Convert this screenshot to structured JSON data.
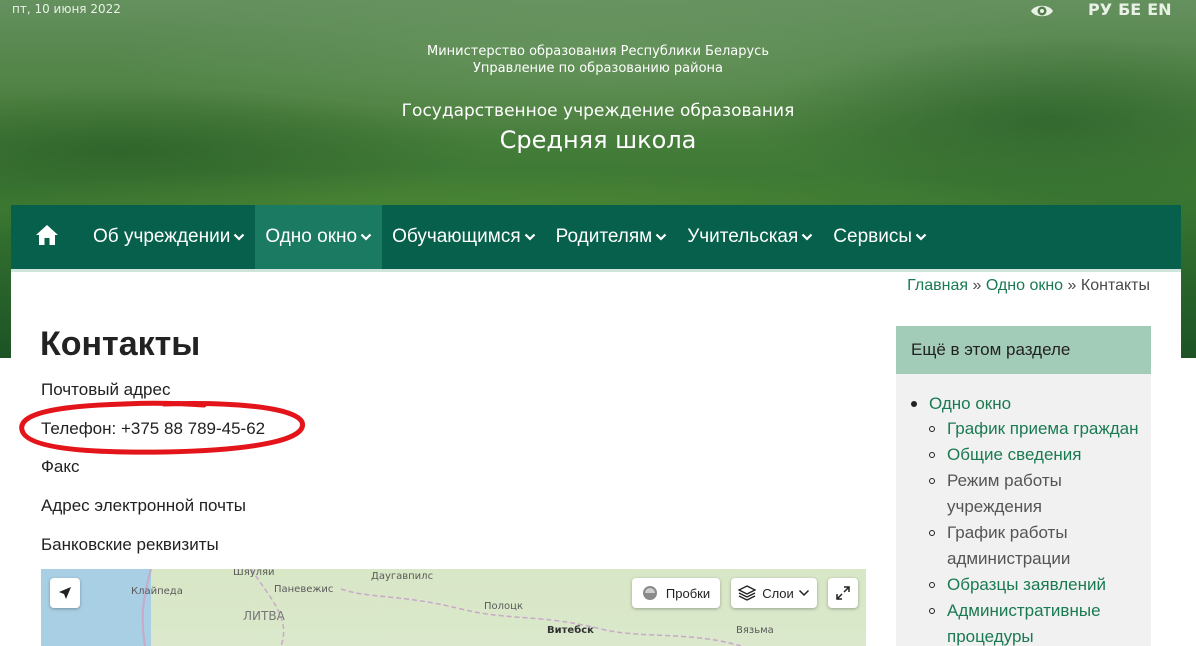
{
  "header": {
    "date": "пт, 10 июня 2022",
    "languages": [
      "РУ",
      "БЕ",
      "EN"
    ],
    "ministry_line1": "Министерство образования Республики Беларусь",
    "ministry_line2": "Управление по образованию района",
    "institution_line1": "Государственное учреждение образования",
    "institution_line2": "Средняя школа"
  },
  "nav": {
    "home_icon": "home-icon",
    "items": [
      {
        "label": "Об учреждении"
      },
      {
        "label": "Одно окно"
      },
      {
        "label": "Обучающимся"
      },
      {
        "label": "Родителям"
      },
      {
        "label": "Учительская"
      },
      {
        "label": "Сервисы"
      }
    ]
  },
  "breadcrumb": {
    "home": "Главная",
    "sep": "»",
    "section": "Одно окно",
    "current": "Контакты"
  },
  "main": {
    "title": "Контакты",
    "lines": [
      "Почтовый адрес",
      "Телефон: +375 88 789-45-62",
      "Факс",
      "Адрес электронной почты",
      "Банковские реквизиты"
    ]
  },
  "map": {
    "traffic_label": "Пробки",
    "layers_label": "Слои",
    "places": [
      "Шяуляй",
      "Даугавпилс",
      "Клайпеда",
      "Паневежис",
      "ЛИТВА",
      "Полоцк",
      "Витебск",
      "Вязьма"
    ]
  },
  "sidebar": {
    "heading": "Ещё в этом разделе",
    "top_item": "Одно окно",
    "items": [
      {
        "label": "График приема граждан",
        "link": true
      },
      {
        "label": "Общие сведения",
        "link": true
      },
      {
        "label": "Режим работы учреждения",
        "link": false
      },
      {
        "label": "График работы администрации",
        "link": false
      },
      {
        "label": "Образцы заявлений",
        "link": true
      },
      {
        "label": "Административные процедуры",
        "link": true
      }
    ]
  },
  "colors": {
    "nav_bg": "#06604b",
    "nav_active": "#1b7a62",
    "link": "#1a7a52",
    "sidebar_head": "#a2cbb8",
    "highlight": "#e3151b"
  }
}
